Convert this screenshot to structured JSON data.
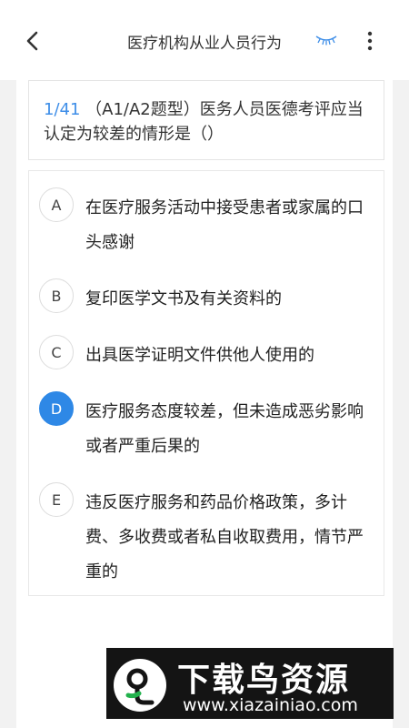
{
  "header": {
    "title": "医疗机构从业人员行为",
    "icons": [
      "back-arrow-icon",
      "eye-closed-icon",
      "more-vertical-icon"
    ]
  },
  "question": {
    "number": "1/41",
    "text": "（A1/A2题型）医务人员医德考评应当认定为较差的情形是（）"
  },
  "options": [
    {
      "letter": "A",
      "text": "在医疗服务活动中接受患者或家属的口头感谢",
      "selected": false
    },
    {
      "letter": "B",
      "text": "复印医学文书及有关资料的",
      "selected": false
    },
    {
      "letter": "C",
      "text": "出具医学证明文件供他人使用的",
      "selected": false
    },
    {
      "letter": "D",
      "text": "医疗服务态度较差，但未造成恶劣影响或者严重后果的",
      "selected": true
    },
    {
      "letter": "E",
      "text": "违反医疗服务和药品价格政策，多计费、多收费或者私自收取费用，情节严重的",
      "selected": false
    }
  ],
  "watermark": {
    "name": "下载鸟资源",
    "url": "www.xiazainiao.com"
  },
  "colors": {
    "accent": "#2e88e6",
    "question_number": "#3e8ee8",
    "background": "#f2f2f2",
    "card": "#ffffff"
  }
}
